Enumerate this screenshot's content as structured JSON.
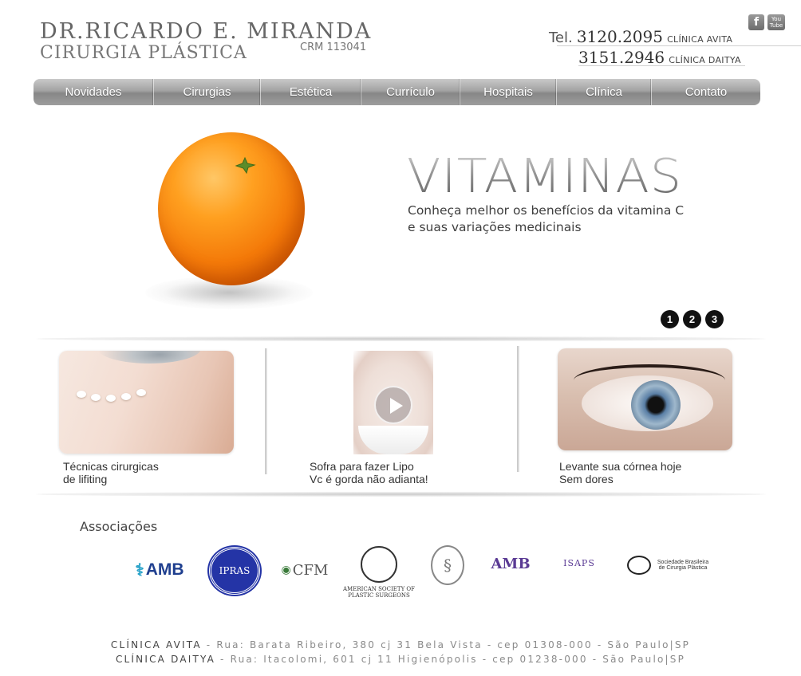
{
  "header": {
    "name": "DR.RICARDO E. MIRANDA",
    "specialty": "CIRURGIA PLÁSTICA",
    "crm": "CRM 113041",
    "phones": [
      {
        "prefix": "Tel.",
        "number": "3120.2095",
        "clinic": "CLÍNICA AVITA"
      },
      {
        "prefix": "",
        "number": "3151.2946",
        "clinic": "CLÍNICA DAITYA"
      }
    ],
    "social": {
      "facebook": "f",
      "youtube_top": "You",
      "youtube_bottom": "Tube"
    }
  },
  "nav": {
    "items": [
      "Novidades",
      "Cirurgias",
      "Estética",
      "Currículo",
      "Hospitais",
      "Clínica",
      "Contato"
    ]
  },
  "hero": {
    "title": "VITAMINAS",
    "caption_line1": "Conheça melhor os benefícios da vitamina C",
    "caption_line2": "e suas variações medicinais",
    "slides": [
      "1",
      "2",
      "3"
    ]
  },
  "features": [
    {
      "line1": "Técnicas cirurgicas",
      "line2": "de lifiting"
    },
    {
      "line1": "Sofra para fazer Lipo",
      "line2": "Vc é gorda não adianta!"
    },
    {
      "line1": "Levante sua córnea hoje",
      "line2": "Sem dores"
    }
  ],
  "associations": {
    "title": "Associações",
    "logos": {
      "amb": "AMB",
      "ipras": "IPRAS",
      "cfm": "CFM",
      "asps_line1": "AMERICAN SOCIETY OF",
      "asps_line2": "PLASTIC SURGEONS",
      "ambh": "AMB",
      "isaps": "ISAPS",
      "sbcp": "Sociedade Brasileira de Cirurgia Plástica"
    }
  },
  "footer": {
    "line1_clinic": "CLÍNICA AVITA",
    "line1_address": " - Rua: Barata Ribeiro, 380 cj 31 Bela Vista - cep 01308-000 - São Paulo|SP",
    "line2_clinic": "CLÍNICA DAITYA",
    "line2_address": " - Rua: Itacolomi, 601 cj 11 Higienópolis - cep 01238-000 - São Paulo|SP"
  },
  "colors": {
    "nav_gradient_top": "#c9c9c9",
    "nav_gradient_bottom": "#878787",
    "orange": "#f47a09",
    "dots": "#111111"
  }
}
